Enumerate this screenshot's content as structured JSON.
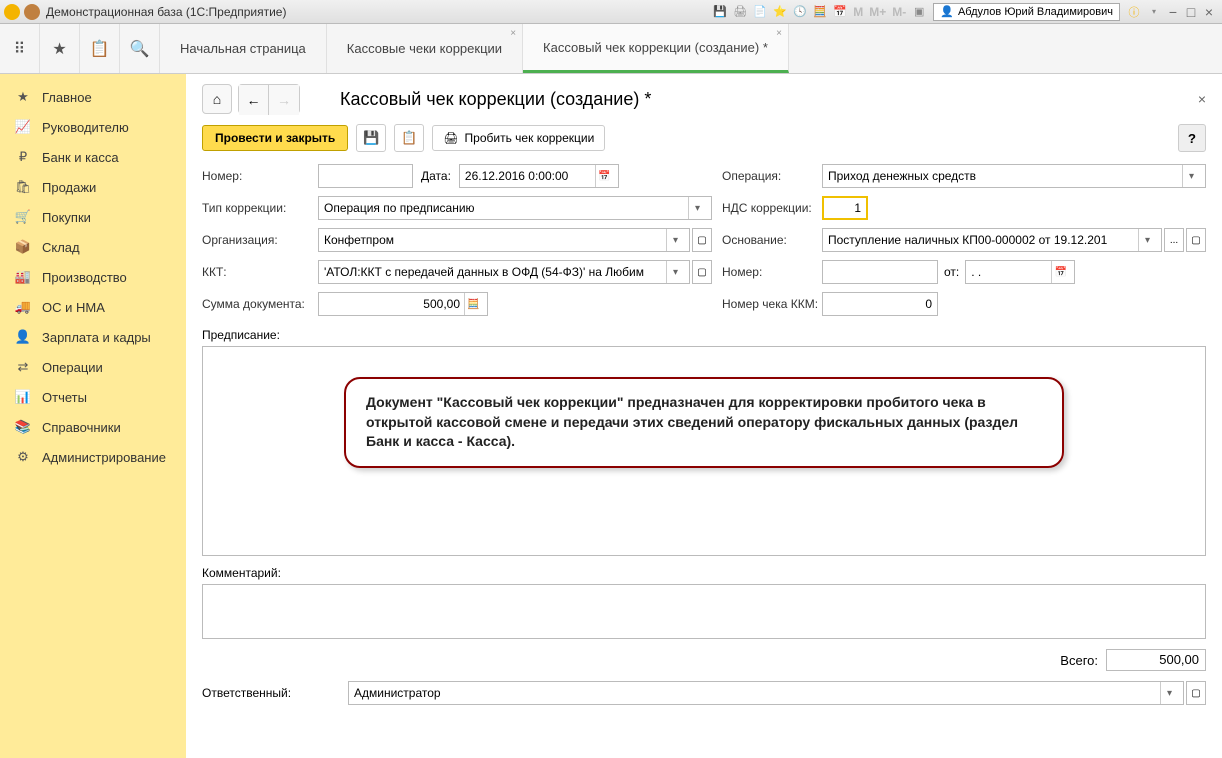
{
  "titlebar": {
    "app_title": "Демонстрационная база  (1С:Предприятие)",
    "user": "Абдулов Юрий Владимирович",
    "m_btn": "M",
    "m_plus": "M+",
    "m_minus": "M-"
  },
  "tabs": {
    "start": "Начальная страница",
    "t1": "Кассовые чеки коррекции",
    "t2": "Кассовый чек коррекции (создание) *"
  },
  "sidebar": {
    "items": [
      {
        "icon": "★",
        "label": "Главное"
      },
      {
        "icon": "📈",
        "label": "Руководителю"
      },
      {
        "icon": "₽",
        "label": "Банк и касса"
      },
      {
        "icon": "🛍",
        "label": "Продажи"
      },
      {
        "icon": "🛒",
        "label": "Покупки"
      },
      {
        "icon": "📦",
        "label": "Склад"
      },
      {
        "icon": "🏭",
        "label": "Производство"
      },
      {
        "icon": "🚚",
        "label": "ОС и НМА"
      },
      {
        "icon": "👤",
        "label": "Зарплата и кадры"
      },
      {
        "icon": "⇄",
        "label": "Операции"
      },
      {
        "icon": "📊",
        "label": "Отчеты"
      },
      {
        "icon": "📚",
        "label": "Справочники"
      },
      {
        "icon": "⚙",
        "label": "Администрирование"
      }
    ]
  },
  "page": {
    "title": "Кассовый чек коррекции (создание) *",
    "cmd": {
      "post_close": "Провести и закрыть",
      "punch": "Пробить чек коррекции",
      "help": "?"
    },
    "labels": {
      "number": "Номер:",
      "date": "Дата:",
      "corr_type": "Тип коррекции:",
      "org": "Организация:",
      "kkt": "ККТ:",
      "sum": "Сумма документа:",
      "operation": "Операция:",
      "vat": "НДС коррекции:",
      "basis": "Основание:",
      "basis_num": "Номер:",
      "basis_from": "от:",
      "kkm_num": "Номер чека ККМ:",
      "prescription": "Предписание:",
      "comment": "Комментарий:",
      "total": "Всего:",
      "responsible": "Ответственный:"
    },
    "values": {
      "number": "",
      "date": "26.12.2016  0:00:00",
      "corr_type": "Операция по предписанию",
      "org": "Конфетпром",
      "kkt": "'АТОЛ:ККТ с передачей данных в ОФД (54-ФЗ)' на Любим",
      "sum": "500,00",
      "operation": "Приход денежных средств",
      "vat": "1",
      "basis": "Поступление наличных КП00-000002 от 19.12.201",
      "basis_num": "",
      "basis_from": ".  .",
      "kkm_num": "0",
      "total": "500,00",
      "responsible": "Администратор",
      "ellipsis": "..."
    },
    "callout": "Документ \"Кассовый чек коррекции\" предназначен для корректировки пробитого чека в открытой кассовой смене и передачи этих сведений оператору фискальных данных  (раздел Банк и касса - Касса)."
  }
}
